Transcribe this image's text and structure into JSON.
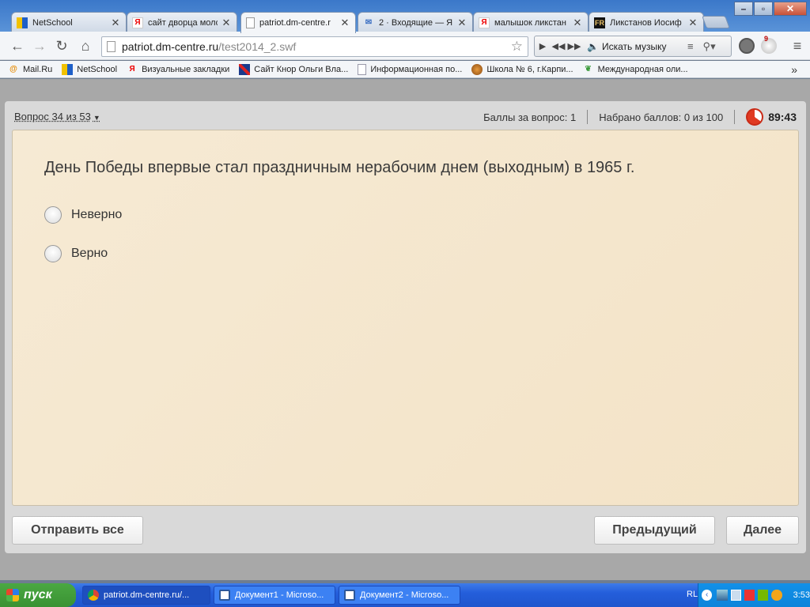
{
  "browser": {
    "tabs": [
      {
        "title": "NetSchool",
        "icon": "netschool-icon",
        "active": false
      },
      {
        "title": "сайт дворца моло",
        "icon": "yandex-icon",
        "active": false
      },
      {
        "title": "patriot.dm-centre.r",
        "icon": "page-icon",
        "active": true
      },
      {
        "title": "2 · Входящие — Я",
        "icon": "mail-icon",
        "active": false
      },
      {
        "title": "малышок ликстан",
        "icon": "yandex-icon",
        "active": false
      },
      {
        "title": "Ликстанов Иосиф",
        "icon": "fr-icon",
        "active": false
      }
    ],
    "url_host": "patriot.dm-centre.ru",
    "url_path": "/test2014_2.swf",
    "music_search_placeholder": "Искать музыку",
    "bookmarks": [
      {
        "label": "Mail.Ru",
        "icon": "mailru-icon"
      },
      {
        "label": "NetSchool",
        "icon": "netschool-icon"
      },
      {
        "label": "Визуальные закладки",
        "icon": "yandex-icon"
      },
      {
        "label": "Сайт Кнор Ольги Вла...",
        "icon": "uk-flag-icon"
      },
      {
        "label": "Информационная по...",
        "icon": "doc-icon"
      },
      {
        "label": "Школа № 6, г.Карпи...",
        "icon": "school-icon"
      },
      {
        "label": "Международная оли...",
        "icon": "leaf-icon"
      }
    ],
    "bookmarks_overflow": "»",
    "ext_badge": "9"
  },
  "quiz": {
    "question_selector": "Вопрос 34 из 53",
    "points_for_question": "Баллы за вопрос: 1",
    "total_points": "Набрано баллов: 0 из 100",
    "timer": "89:43",
    "question_text": "День Победы впервые стал праздничным нерабочим днем (выходным) в 1965 г.",
    "options": [
      {
        "label": "Неверно",
        "selected": false
      },
      {
        "label": "Верно",
        "selected": false
      }
    ],
    "submit_all_label": "Отправить все",
    "previous_label": "Предыдущий",
    "next_label": "Далее"
  },
  "taskbar": {
    "start_label": "пуск",
    "tasks": [
      {
        "label": "patriot.dm-centre.ru/...",
        "icon": "chrome-icon",
        "active": true
      },
      {
        "label": "Документ1 - Microso...",
        "icon": "word-icon",
        "active": false
      },
      {
        "label": "Документ2 - Microso...",
        "icon": "word-icon",
        "active": false
      }
    ],
    "language": "RL",
    "clock": "3:53"
  },
  "colors": {
    "card_bg": "#f6ead4",
    "timer_red": "#e03a22",
    "taskbar_blue": "#245edb",
    "start_green": "#3a9233"
  }
}
